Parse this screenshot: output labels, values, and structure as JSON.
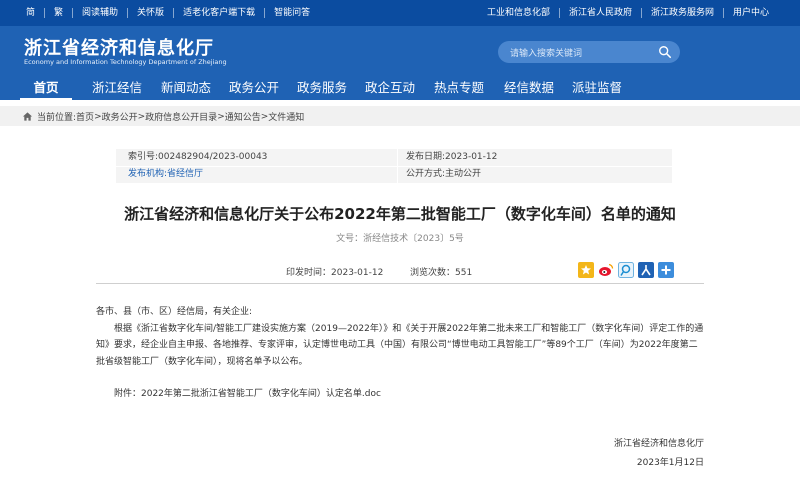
{
  "topbar": {
    "left": [
      "简",
      "繁",
      "阅读辅助",
      "关怀版",
      "适老化客户端下载",
      "智能问答"
    ],
    "right": [
      "工业和信息化部",
      "浙江省人民政府",
      "浙江政务服务网",
      "用户中心"
    ]
  },
  "header": {
    "title_cn": "浙江省经济和信息化厅",
    "title_en": "Economy and Information Technology Department of Zhejiang",
    "search_placeholder": "请输入搜索关键词"
  },
  "nav": [
    "首页",
    "浙江经信",
    "新闻动态",
    "政务公开",
    "政务服务",
    "政企互动",
    "热点专题",
    "经信数据",
    "派驻监督"
  ],
  "breadcrumb": {
    "prefix": "当前位置:",
    "items": [
      "首页",
      "政务公开",
      "政府信息公开目录",
      "通知公告",
      "文件通知"
    ],
    "sep": ">"
  },
  "meta": {
    "index_label": "索引号:",
    "index_value": "002482904/2023-00043",
    "date_label": "发布日期:",
    "date_value": "2023-01-12",
    "org_label": "发布机构:",
    "org_value": "省经信厅",
    "mode_label": "公开方式:",
    "mode_value": "主动公开"
  },
  "article": {
    "title": "浙江省经济和信息化厅关于公布2022年第二批智能工厂（数字化车间）名单的通知",
    "doc_no": "文号：浙经信技术〔2023〕5号",
    "pub_time_label": "印发时间：",
    "pub_time": "2023-01-12",
    "views_label": "浏览次数：",
    "views": "551",
    "salutation": "各市、县（市、区）经信局，有关企业:",
    "paragraph": "根据《浙江省数字化车间/智能工厂建设实施方案（2019—2022年）》和《关于开展2022年第二批未来工厂和智能工厂（数字化车间）评定工作的通知》要求，经企业自主申报、各地推荐、专家评审，认定博世电动工具（中国）有限公司“博世电动工具智能工厂”等89个工厂（车间）为2022年度第二批省级智能工厂（数字化车间），现将名单予以公布。",
    "attachment": "附件：2022年第二批浙江省智能工厂（数字化车间）认定名单.doc",
    "sign_org": "浙江省经济和信息化厅",
    "sign_date": "2023年1月12日"
  },
  "share_icons": [
    "qzone-icon",
    "weibo-icon",
    "tencent-weibo-icon",
    "renren-icon",
    "more-share-icon"
  ],
  "colors": {
    "primary": "#1f62b4",
    "topbar": "#0b4ca0",
    "link": "#1f62b4"
  }
}
